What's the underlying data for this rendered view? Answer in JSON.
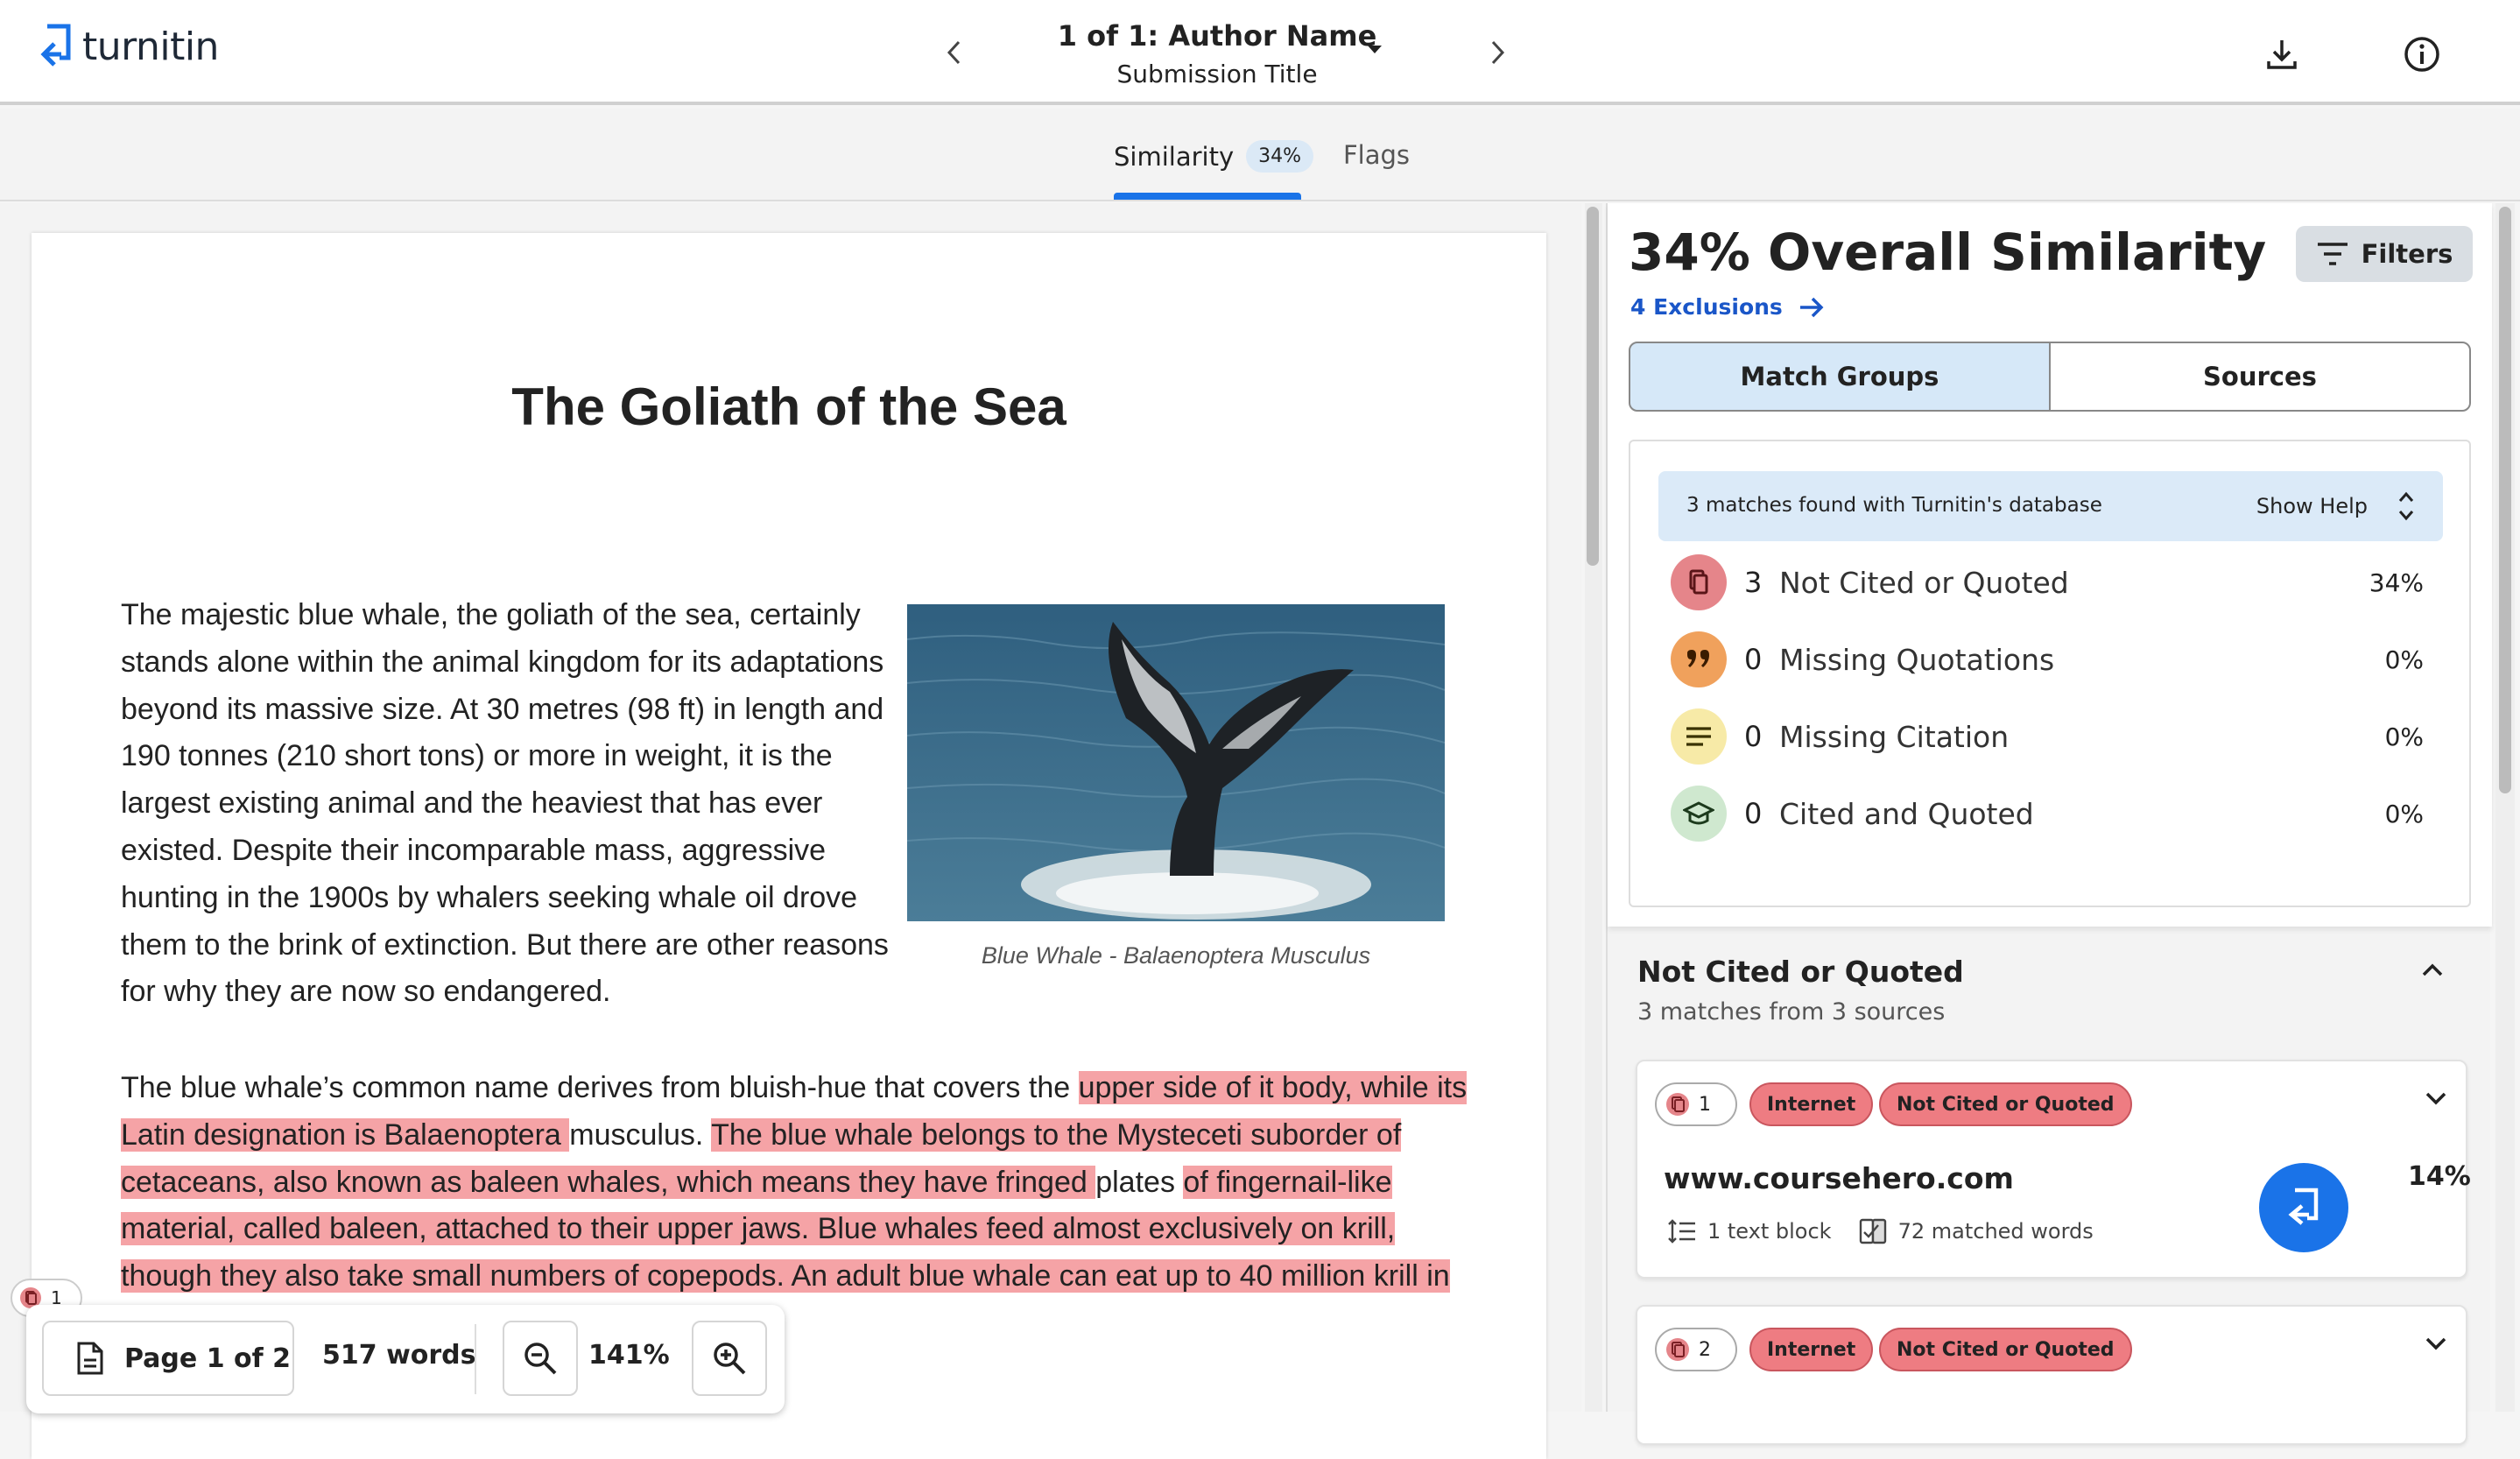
{
  "app": {
    "logo_text": "turnitin"
  },
  "header": {
    "submission_line": "1 of 1: Author Name",
    "submission_title": "Submission Title"
  },
  "tabs": {
    "similarity_label": "Similarity",
    "similarity_badge": "34%",
    "flags_label": "Flags"
  },
  "document": {
    "title": "The Goliath of the Sea",
    "caption": "Blue Whale - Balaenoptera Musculus",
    "para1": "The majestic blue whale, the goliath of the sea, certainly stands alone within the animal kingdom for its adaptations beyond its massive size. At 30 metres (98 ft) in length and 190 tonnes (210 short tons) or more in weight, it is the largest existing animal and the heaviest that has ever existed. Despite their incomparable mass, aggressive hunting in the 1900s by whalers seeking whale oil drove them to the brink of extinction. But there are other reasons for why they are now so endangered.",
    "para2_seg1": "The blue whale’s common name derives from bluish-hue that covers the ",
    "para2_seg2": "upper side of it body, while its Latin designation is Balaenoptera ",
    "para2_seg3": "musculus. ",
    "para2_seg4": "The blue whale belongs to the Mysteceti suborder of cetaceans, also known as baleen whales, which means they have fringed ",
    "para2_seg5": "plates ",
    "para2_seg6": "of fingernail-like material, called baleen, attached to their upper jaws. Blue whales feed almost exclusively on krill, though they also take small numbers of copepods. An adult blue whale can eat up to 40 million krill in",
    "margin_marker_count": "1"
  },
  "toolbar": {
    "page_label": "Page 1 of 2",
    "words_label": "517 words",
    "zoom_value": "141%"
  },
  "panel": {
    "overall_title": "34% Overall Similarity",
    "filters_label": "Filters",
    "exclusions_label": "4 Exclusions",
    "seg_match_groups": "Match Groups",
    "seg_sources": "Sources",
    "help_text": "3 matches found with Turnitin's database",
    "show_help": "Show Help",
    "categories": [
      {
        "count": "3",
        "label": "Not Cited or Quoted",
        "pct": "34%",
        "color": "#e5858a"
      },
      {
        "count": "0",
        "label": "Missing Quotations",
        "pct": "0%",
        "color": "#f0a15c"
      },
      {
        "count": "0",
        "label": "Missing Citation",
        "pct": "0%",
        "color": "#f7eaa7"
      },
      {
        "count": "0",
        "label": "Cited and Quoted",
        "pct": "0%",
        "color": "#cfe8cf"
      }
    ],
    "section_title": "Not Cited or Quoted",
    "section_sub": "3 matches from 3 sources",
    "cards": [
      {
        "num": "1",
        "type": "Internet",
        "category": "Not Cited or Quoted",
        "source": "www.coursehero.com",
        "blocks": "1 text block",
        "matched": "72 matched words",
        "pct": "14%"
      },
      {
        "num": "2",
        "type": "Internet",
        "category": "Not Cited or Quoted"
      }
    ]
  },
  "colors": {
    "accent": "#1a73e8",
    "highlight": "#f5a3a6",
    "chip_red": "#ee7c82"
  }
}
